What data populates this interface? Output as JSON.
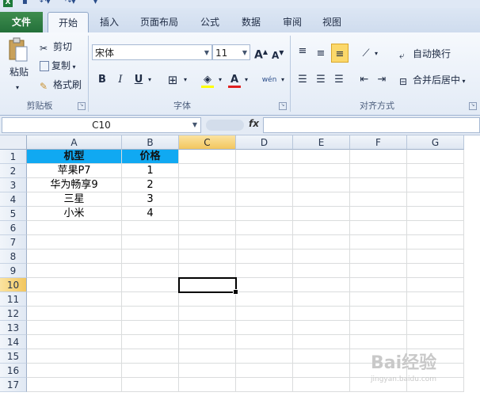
{
  "ribbon_tabs": [
    "文件",
    "开始",
    "插入",
    "页面布局",
    "公式",
    "数据",
    "审阅",
    "视图"
  ],
  "clipboard": {
    "paste": "粘贴",
    "cut": "剪切",
    "copy": "复制",
    "format_painter": "格式刷",
    "group_label": "剪贴板"
  },
  "font": {
    "name": "宋体",
    "size": "11",
    "bold": "B",
    "italic": "I",
    "underline": "U",
    "grow": "A",
    "shrink": "A",
    "phonetic": "wén",
    "group_label": "字体"
  },
  "alignment": {
    "wrap_text": "自动换行",
    "merge_center": "合并后居中",
    "group_label": "对齐方式"
  },
  "formula_bar": {
    "name_box": "C10",
    "fx": "fx",
    "value": ""
  },
  "sheet": {
    "columns": [
      "A",
      "B",
      "C",
      "D",
      "E",
      "F",
      "G"
    ],
    "rows": [
      "1",
      "2",
      "3",
      "4",
      "5",
      "6",
      "7",
      "8",
      "9",
      "10",
      "11",
      "12",
      "13",
      "14",
      "15",
      "16",
      "17"
    ],
    "header": [
      "机型",
      "价格"
    ],
    "data": [
      [
        "苹果P7",
        "1"
      ],
      [
        "华为畅享9",
        "2"
      ],
      [
        "三星",
        "3"
      ],
      [
        "小米",
        "4"
      ]
    ],
    "active_cell": "C10"
  },
  "watermark": {
    "brand": "Bai经验",
    "url": "jingyan.baidu.com"
  },
  "colors": {
    "header_fill": "#10a9f2",
    "selected_header": "#f2c65e",
    "file_tab": "#23703a"
  }
}
